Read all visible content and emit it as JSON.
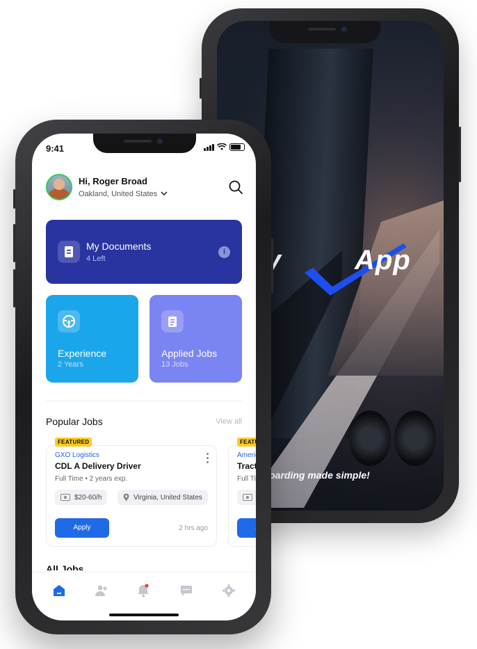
{
  "status_bar": {
    "time": "9:41"
  },
  "profile": {
    "greeting": "Hi, Roger Broad",
    "location": "Oakland, United States"
  },
  "documents": {
    "title": "My Documents",
    "subtitle": "4 Left"
  },
  "tiles": [
    {
      "title": "Experience",
      "subtitle": "2 Years"
    },
    {
      "title": "Applied Jobs",
      "subtitle": "13 Jobs"
    }
  ],
  "popular_jobs": {
    "heading": "Popular Jobs",
    "view_all": "View all",
    "jobs": [
      {
        "badge": "FEATURED",
        "company": "GXO Logistics",
        "title": "CDL A Delivery Driver",
        "meta": "Full Time • 2 years exp.",
        "pay": "$20-60/h",
        "location": "Virginia, United States",
        "apply": "Apply",
        "posted": "2 hrs ago"
      },
      {
        "badge": "FEATURED",
        "company": "Americ",
        "title": "Tract",
        "meta": "Full Ti",
        "apply": "Apply"
      }
    ]
  },
  "next_section_peek": "All Jobs",
  "tabbar": [
    "home-icon",
    "users-icon",
    "bell-icon",
    "chat-icon",
    "gear-icon"
  ],
  "splash": {
    "brand_left": "eady",
    "brand_right": "App",
    "tagline": "nboarding made simple!"
  },
  "colors": {
    "primary": "#1f6ae6",
    "documents_card": "#2934a1",
    "experience": "#1ba6ec",
    "applied": "#7b84f3",
    "featured": "#ffcc1e"
  }
}
